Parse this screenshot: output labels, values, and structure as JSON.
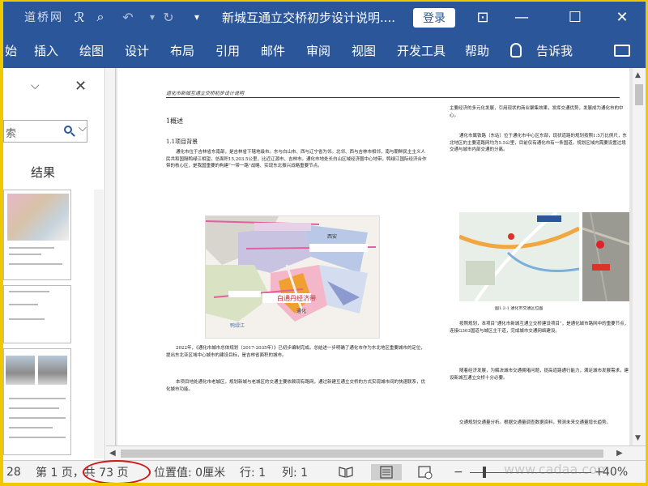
{
  "titlebar": {
    "logo_text": "道桥网",
    "undo_icon": "undo-icon",
    "redo_icon": "redo-icon",
    "doc_title": "新城互通立交桥初步设计说明....",
    "login_label": "登录",
    "icons": [
      "save-icon",
      "spellcheck-icon",
      "print-preview-icon",
      "undo-icon",
      "redo-icon",
      "customize-icon",
      "ribbon-display-icon",
      "minimize-icon",
      "maximize-icon",
      "close-icon"
    ]
  },
  "ribbon": {
    "tabs": [
      "始",
      "插入",
      "绘图",
      "设计",
      "布局",
      "引用",
      "邮件",
      "审阅",
      "视图",
      "开发工具",
      "帮助"
    ],
    "tell_me": "告诉我"
  },
  "navpane": {
    "search_placeholder": "索",
    "results_label": "结果"
  },
  "document": {
    "header_text": "道化市新城互通立交桥初步设计说明",
    "heading1": "1概述",
    "heading2": "1.1项目背景",
    "para1": "通化市位于吉林省东南部，是吉林省下辖地级市。东与白山市、西与辽宁省为邻。北邻、西与吉林市相邻，南与朝鲜民主主义人民共和国隔鸭绿江相望。总面积15,203.5公里，比近辽源市、吉林市。通化市地处长白山区域经济圈中心地带，鸭绿江国际经济合作带的核心区，是我国重要的构建“一带一路”战略、实现东北振兴战略重要节点。",
    "para2": "2022年，《通化市城市总体规划（2017-2035年）》已初步编制完成。总结进一步明确了通化市作为东北地区重要城市的定位，提出东北亚区域中心城市的建设目标，是吉林省面积的城市。",
    "para3": "本项目地处通化市老城区，规划新城与老城区的交通主要依赖现有路网，通过新建互通立交桥的方式实现城市间的快速联系，优化城市功能。",
    "right_col1": "主要经济的多元化发展，引用现状的商业聚集效果，发挥交通优势，发展成为通化市的中心。",
    "right_col2": "通化市属铁路（东站）位于通化市中心区东部，现状道路的规划按照1:5万比例尺，东北地区的主要道路网均为5.5公里，目前仅有通化市有一条国道。规划区域内需要设置过境交通与城市内部交通的分离。",
    "map_caption": "图1.2-1 通化市交通区位图",
    "right_col3": "按照规划，本项目“通化市新城互通立交桥建设项目”，是通化城市路网中的重要节点，连接G303国道与城区主干道，完成城市交通网络建设。",
    "right_col4": "随着经济发展，为解决城市交通拥堵问题，提高道路通行能力，满足城市发展需求，建设新城互通立交桥十分必要。",
    "right_col5": "交通规划交通量分析。根据交通量调查数据资料，预测未来交通量增长趋势。",
    "map_labels": [
      "白通丹经济带",
      "通化",
      "鸭绿江",
      "西安"
    ]
  },
  "statusbar": {
    "word_count_partial": "28",
    "page_info": "第 1 页，共 73 页",
    "position": "位置值: 0厘米",
    "line": "行: 1",
    "column": "列: 1",
    "zoom": "40%",
    "watermark": "www.cadaa.com"
  }
}
